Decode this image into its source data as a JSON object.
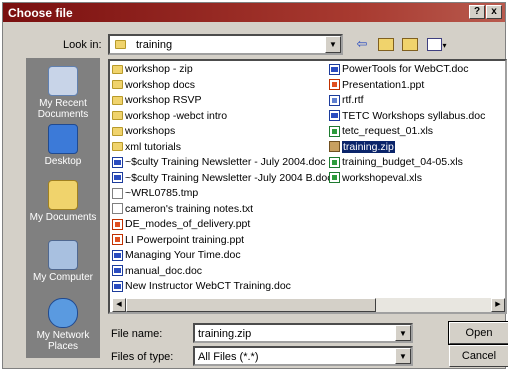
{
  "window": {
    "title": "Choose file",
    "help_label": "?",
    "close_label": "x"
  },
  "lookin": {
    "label": "Look in:",
    "value": "training"
  },
  "toolbar": {
    "back_icon": "back-arrow-icon",
    "up_icon": "up-folder-icon",
    "new_icon": "new-folder-icon",
    "view_icon": "view-menu-icon"
  },
  "places": [
    {
      "name": "My Recent Documents",
      "icon": "recent-documents-icon"
    },
    {
      "name": "Desktop",
      "icon": "desktop-icon"
    },
    {
      "name": "My Documents",
      "icon": "my-documents-icon"
    },
    {
      "name": "My Computer",
      "icon": "my-computer-icon"
    },
    {
      "name": "My Network Places",
      "icon": "network-places-icon"
    }
  ],
  "files_col1": [
    {
      "name": "workshop - zip",
      "type": "folder"
    },
    {
      "name": "workshop docs",
      "type": "folder"
    },
    {
      "name": "workshop RSVP",
      "type": "folder"
    },
    {
      "name": "workshop -webct intro",
      "type": "folder"
    },
    {
      "name": "workshops",
      "type": "folder"
    },
    {
      "name": "xml tutorials",
      "type": "folder"
    },
    {
      "name": "~$culty Training Newsletter - July 2004.doc",
      "type": "word"
    },
    {
      "name": "~$culty Training Newsletter -July 2004 B.doc",
      "type": "word"
    },
    {
      "name": "~WRL0785.tmp",
      "type": "file"
    },
    {
      "name": "cameron's training notes.txt",
      "type": "file"
    },
    {
      "name": "DE_modes_of_delivery.ppt",
      "type": "ppt"
    },
    {
      "name": "LI Powerpoint training.ppt",
      "type": "ppt"
    },
    {
      "name": "Managing Your Time.doc",
      "type": "word"
    },
    {
      "name": "manual_doc.doc",
      "type": "word"
    },
    {
      "name": "New Instructor WebCT Training.doc",
      "type": "word"
    }
  ],
  "files_col2": [
    {
      "name": "PowerTools for WebCT.doc",
      "type": "word"
    },
    {
      "name": "Presentation1.ppt",
      "type": "ppt"
    },
    {
      "name": "rtf.rtf",
      "type": "rtf"
    },
    {
      "name": "TETC Workshops syllabus.doc",
      "type": "word"
    },
    {
      "name": "tetc_request_01.xls",
      "type": "xls"
    },
    {
      "name": "training.zip",
      "type": "zip",
      "selected": true
    },
    {
      "name": "training_budget_04-05.xls",
      "type": "xls"
    },
    {
      "name": "workshopeval.xls",
      "type": "xls"
    }
  ],
  "filename": {
    "label": "File name:",
    "value": "training.zip"
  },
  "filetype": {
    "label": "Files of type:",
    "value": "All Files (*.*)"
  },
  "buttons": {
    "open": "Open",
    "cancel": "Cancel"
  }
}
